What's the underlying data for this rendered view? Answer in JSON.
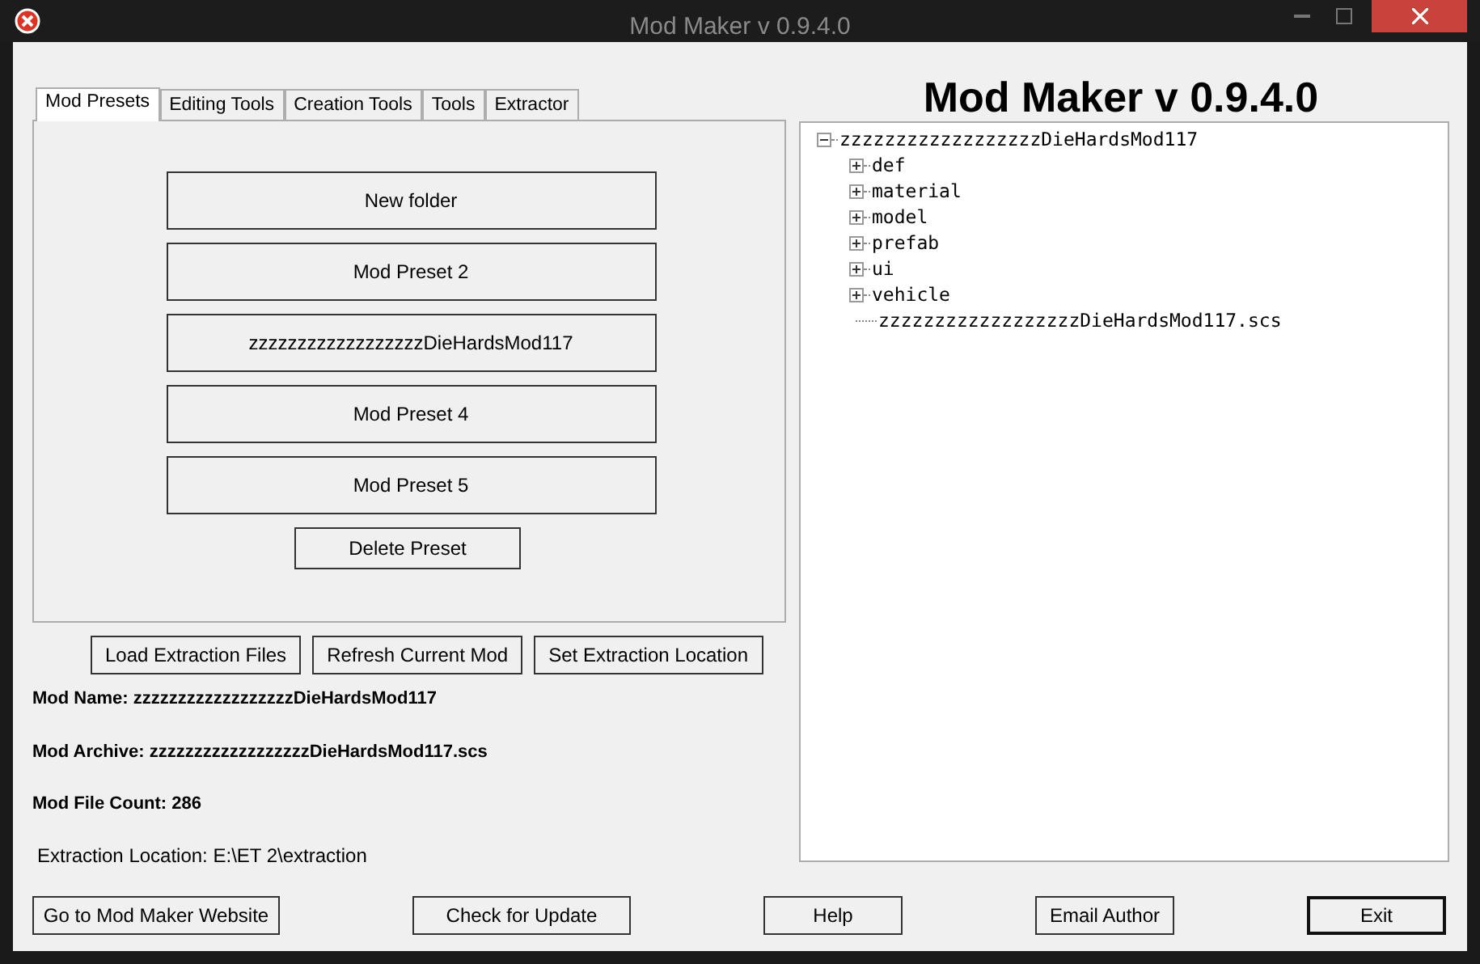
{
  "window": {
    "title": "Mod Maker v 0.9.4.0"
  },
  "tabs": [
    {
      "label": "Mod Presets",
      "selected": true
    },
    {
      "label": "Editing Tools",
      "selected": false
    },
    {
      "label": "Creation Tools",
      "selected": false
    },
    {
      "label": "Tools",
      "selected": false
    },
    {
      "label": "Extractor",
      "selected": false
    }
  ],
  "presets": [
    "New folder",
    "Mod Preset 2",
    "zzzzzzzzzzzzzzzzzzDieHardsMod117",
    "Mod Preset 4",
    "Mod Preset 5"
  ],
  "delete_button": "Delete Preset",
  "action_buttons": [
    "Load Extraction Files",
    "Refresh Current Mod",
    "Set Extraction Location"
  ],
  "info": [
    {
      "text": "Mod Name: zzzzzzzzzzzzzzzzzzDieHardsMod117",
      "kind": "bold"
    },
    {
      "text": "Mod Archive: zzzzzzzzzzzzzzzzzzDieHardsMod117.scs",
      "kind": "bold"
    },
    {
      "text": "Mod File Count: 286",
      "kind": "bold"
    },
    {
      "text": "Extraction Location: E:\\ET 2\\extraction",
      "kind": "plain"
    }
  ],
  "heading": "Mod Maker v 0.9.4.0",
  "tree": [
    {
      "label": "zzzzzzzzzzzzzzzzzzDieHardsMod117",
      "expanded": true,
      "children": [
        {
          "label": "def",
          "expanded": false
        },
        {
          "label": "material",
          "expanded": false
        },
        {
          "label": "model",
          "expanded": false
        },
        {
          "label": "prefab",
          "expanded": false
        },
        {
          "label": "ui",
          "expanded": false
        },
        {
          "label": "vehicle",
          "expanded": false
        },
        {
          "label": "zzzzzzzzzzzzzzzzzzDieHardsMod117.scs"
        }
      ]
    }
  ],
  "bottom_buttons": [
    {
      "label": "Go to Mod Maker Website",
      "default": false
    },
    {
      "label": "Check for Update",
      "default": false
    },
    {
      "label": "Help",
      "default": false
    },
    {
      "label": "Email Author",
      "default": false
    },
    {
      "label": "Exit",
      "default": true
    }
  ]
}
